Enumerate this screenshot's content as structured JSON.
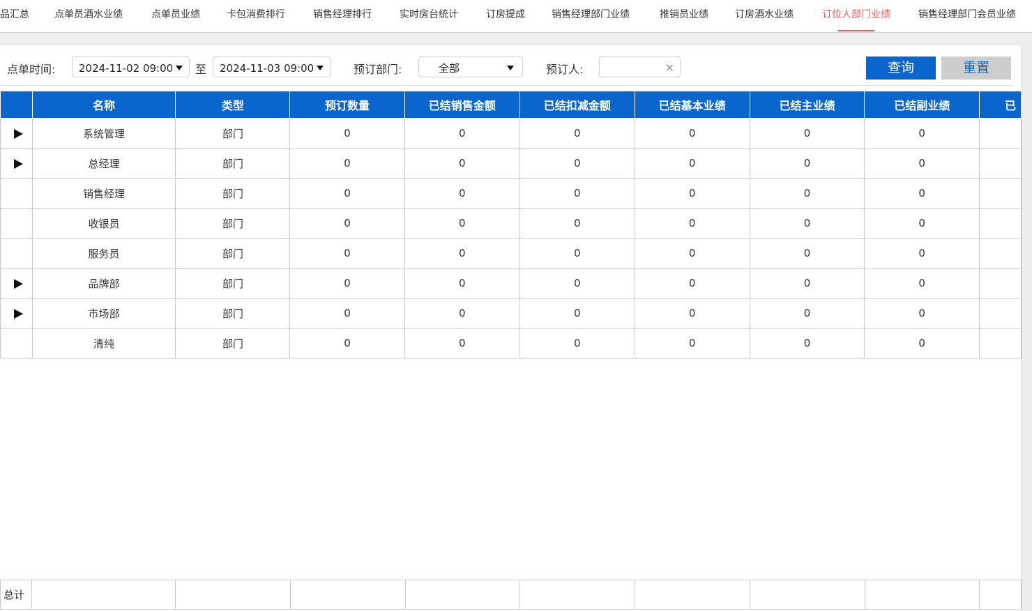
{
  "tabs": [
    {
      "label": "品汇总",
      "active": false
    },
    {
      "label": "点单员酒水业绩",
      "active": false
    },
    {
      "label": "点单员业绩",
      "active": false
    },
    {
      "label": "卡包消费排行",
      "active": false
    },
    {
      "label": "销售经理排行",
      "active": false
    },
    {
      "label": "实时房台统计",
      "active": false
    },
    {
      "label": "订房提成",
      "active": false
    },
    {
      "label": "销售经理部门业绩",
      "active": false
    },
    {
      "label": "推销员业绩",
      "active": false
    },
    {
      "label": "订房酒水业绩",
      "active": false
    },
    {
      "label": "订位人部门业绩",
      "active": true
    },
    {
      "label": "销售经理部门会员业绩",
      "active": false
    }
  ],
  "filters": {
    "order_time_label": "点单时间:",
    "start_time": "2024-11-02 09:00",
    "to_label": "至",
    "end_time": "2024-11-03 09:00",
    "dept_label": "预订部门:",
    "dept_value": "全部",
    "booker_label": "预订人:",
    "booker_value": "",
    "clear_glyph": "×",
    "query_label": "查询",
    "reset_label": "重置"
  },
  "table": {
    "columns": [
      "",
      "名称",
      "类型",
      "预订数量",
      "已结销售金额",
      "已结扣减金额",
      "已结基本业绩",
      "已结主业绩",
      "已结副业绩",
      "已"
    ],
    "rows": [
      {
        "expandable": true,
        "name": "系统管理",
        "type": "部门",
        "values": [
          "0",
          "0",
          "0",
          "0",
          "0",
          "0"
        ]
      },
      {
        "expandable": true,
        "name": "总经理",
        "type": "部门",
        "values": [
          "0",
          "0",
          "0",
          "0",
          "0",
          "0"
        ]
      },
      {
        "expandable": false,
        "name": "销售经理",
        "type": "部门",
        "values": [
          "0",
          "0",
          "0",
          "0",
          "0",
          "0"
        ]
      },
      {
        "expandable": false,
        "name": "收银员",
        "type": "部门",
        "values": [
          "0",
          "0",
          "0",
          "0",
          "0",
          "0"
        ]
      },
      {
        "expandable": false,
        "name": "服务员",
        "type": "部门",
        "values": [
          "0",
          "0",
          "0",
          "0",
          "0",
          "0"
        ]
      },
      {
        "expandable": true,
        "name": "品牌部",
        "type": "部门",
        "values": [
          "0",
          "0",
          "0",
          "0",
          "0",
          "0"
        ]
      },
      {
        "expandable": true,
        "name": "市场部",
        "type": "部门",
        "values": [
          "0",
          "0",
          "0",
          "0",
          "0",
          "0"
        ]
      },
      {
        "expandable": false,
        "name": "清纯",
        "type": "部门",
        "values": [
          "0",
          "0",
          "0",
          "0",
          "0",
          "0"
        ]
      }
    ]
  },
  "totals": {
    "label": "总计"
  },
  "colors": {
    "accent": "#0a66cc",
    "active_tab": "#e85a5a"
  }
}
